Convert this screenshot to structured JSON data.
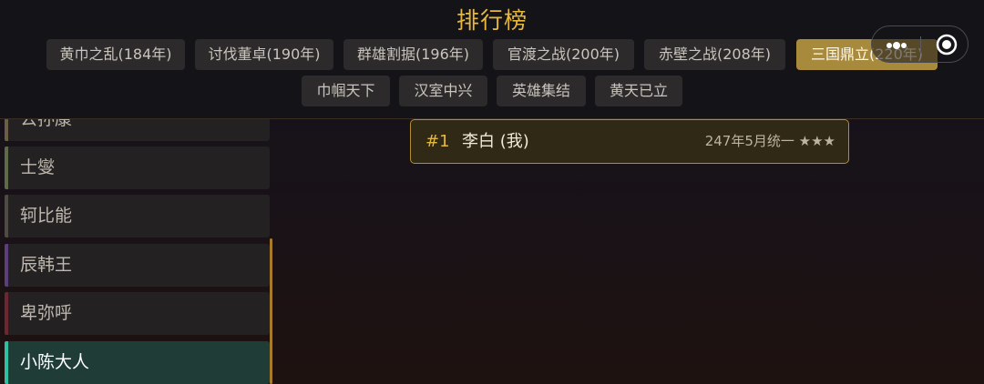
{
  "title": "排行榜",
  "tabs_row1": [
    {
      "label": "黄巾之乱(184年)"
    },
    {
      "label": "讨伐董卓(190年)"
    },
    {
      "label": "群雄割据(196年)"
    },
    {
      "label": "官渡之战(200年)"
    },
    {
      "label": "赤壁之战(208年)"
    },
    {
      "label": "三国鼎立(220年)",
      "active": true
    }
  ],
  "tabs_row2": [
    {
      "label": "巾帼天下"
    },
    {
      "label": "汉室中兴"
    },
    {
      "label": "英雄集结"
    },
    {
      "label": "黄天已立"
    }
  ],
  "sidebar": {
    "items": [
      {
        "label": "公孙康",
        "accent": "#6b5e44"
      },
      {
        "label": "士燮",
        "accent": "#5e6b48"
      },
      {
        "label": "轲比能",
        "accent": "#4e4a44"
      },
      {
        "label": "辰韩王",
        "accent": "#5a3f7a"
      },
      {
        "label": "卑弥呼",
        "accent": "#6e2630"
      },
      {
        "label": "小陈大人",
        "accent": "#2fbfa2",
        "selected": true
      }
    ]
  },
  "ranking": [
    {
      "rank": "#1",
      "name": "李白 (我)",
      "date": "247年5月统一 ★★★"
    }
  ],
  "colors": {
    "title_gold": "#e6b93c",
    "active_tab": "#a88a3c",
    "card_border": "#b48d2e",
    "selected_item": "#1f3c37"
  },
  "icons": {
    "capsule_menu": "more-dots-icon",
    "capsule_close": "target-circle-icon"
  }
}
